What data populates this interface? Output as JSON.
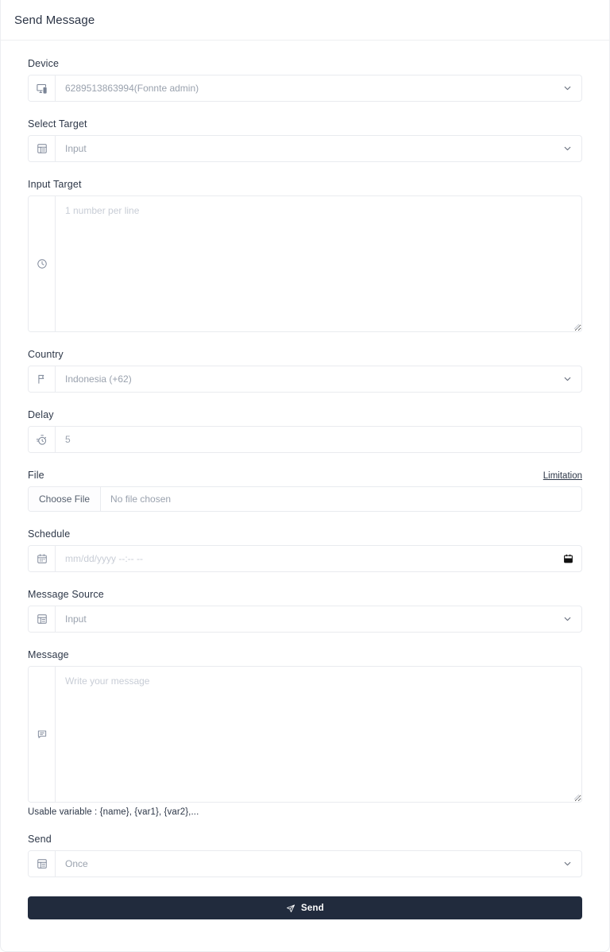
{
  "header": {
    "title": "Send Message"
  },
  "form": {
    "device": {
      "label": "Device",
      "icon": "device-mobile-desktop-icon",
      "value": "6289513863994(Fonnte admin)",
      "chevron": "chevron-down-icon"
    },
    "select_target": {
      "label": "Select Target",
      "icon": "list-table-icon",
      "value": "Input",
      "chevron": "chevron-down-icon"
    },
    "input_target": {
      "label": "Input Target",
      "icon": "clock-icon",
      "placeholder": "1 number per line",
      "value": ""
    },
    "country": {
      "label": "Country",
      "icon": "flag-icon",
      "value": "Indonesia (+62)",
      "chevron": "chevron-down-icon"
    },
    "delay": {
      "label": "Delay",
      "icon": "stopwatch-icon",
      "value": "5"
    },
    "file": {
      "label": "File",
      "limitation_link": "Limitation",
      "choose_button": "Choose File",
      "file_status": "No file chosen"
    },
    "schedule": {
      "label": "Schedule",
      "icon": "calendar-icon",
      "placeholder": "mm/dd/yyyy --:-- --",
      "picker_icon": "calendar-picker-icon",
      "value": ""
    },
    "message_source": {
      "label": "Message Source",
      "icon": "list-table-icon",
      "value": "Input",
      "chevron": "chevron-down-icon"
    },
    "message": {
      "label": "Message",
      "icon": "chat-bubble-icon",
      "placeholder": "Write your message",
      "value": "",
      "helper": "Usable variable : {name}, {var1}, {var2},..."
    },
    "send_mode": {
      "label": "Send",
      "icon": "list-table-icon",
      "value": "Once",
      "chevron": "chevron-down-icon"
    },
    "submit": {
      "label": "Send",
      "icon": "paper-plane-icon",
      "color": "#212b3d"
    }
  }
}
